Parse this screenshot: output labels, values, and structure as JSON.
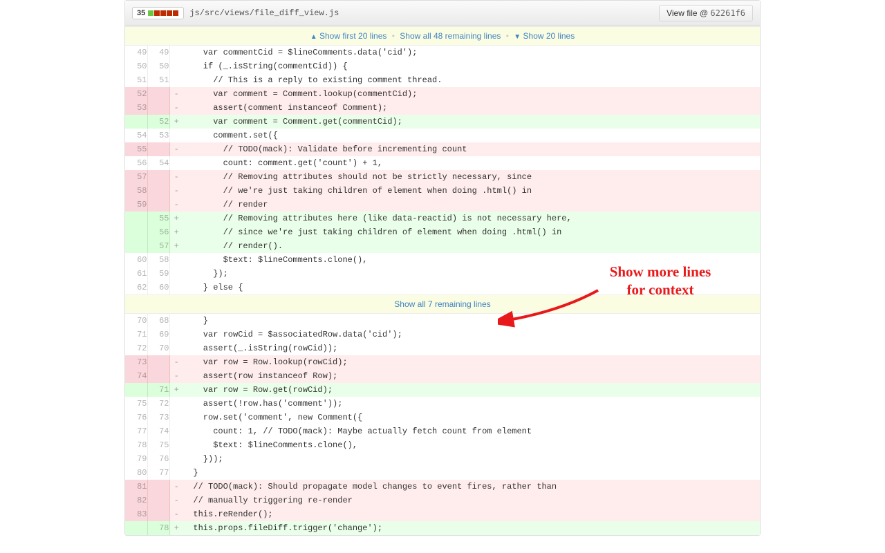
{
  "header": {
    "diffstat_count": "35",
    "file_path": "js/src/views/file_diff_view.js",
    "view_file_label": "View file @",
    "commit_sha": "62261f6"
  },
  "expand_top": {
    "show_first": "Show first 20 lines",
    "show_all": "Show all 48 remaining lines",
    "show_next": "Show 20 lines"
  },
  "expand_mid": {
    "show_all": "Show all 7 remaining lines"
  },
  "annotation_text": "Show more lines\nfor context",
  "rows": [
    {
      "t": "ctx",
      "ol": "49",
      "nl": "49",
      "s": " ",
      "c": "    var commentCid = $lineComments.data('cid');"
    },
    {
      "t": "ctx",
      "ol": "50",
      "nl": "50",
      "s": " ",
      "c": "    if (_.isString(commentCid)) {"
    },
    {
      "t": "ctx",
      "ol": "51",
      "nl": "51",
      "s": " ",
      "c": "      // This is a reply to existing comment thread."
    },
    {
      "t": "del",
      "ol": "52",
      "nl": "",
      "s": "-",
      "c": "      var comment = Comment.lookup(commentCid);"
    },
    {
      "t": "del",
      "ol": "53",
      "nl": "",
      "s": "-",
      "c": "      assert(comment instanceof Comment);"
    },
    {
      "t": "add",
      "ol": "",
      "nl": "52",
      "s": "+",
      "c": "      var comment = Comment.get(commentCid);"
    },
    {
      "t": "ctx",
      "ol": "54",
      "nl": "53",
      "s": " ",
      "c": "      comment.set({"
    },
    {
      "t": "del",
      "ol": "55",
      "nl": "",
      "s": "-",
      "c": "        // TODO(mack): Validate before incrementing count"
    },
    {
      "t": "ctx",
      "ol": "56",
      "nl": "54",
      "s": " ",
      "c": "        count: comment.get('count') + 1,"
    },
    {
      "t": "del",
      "ol": "57",
      "nl": "",
      "s": "-",
      "c": "        // Removing attributes should not be strictly necessary, since"
    },
    {
      "t": "del",
      "ol": "58",
      "nl": "",
      "s": "-",
      "c": "        // we're just taking children of element when doing .html() in"
    },
    {
      "t": "del",
      "ol": "59",
      "nl": "",
      "s": "-",
      "c": "        // render"
    },
    {
      "t": "add",
      "ol": "",
      "nl": "55",
      "s": "+",
      "c": "        // Removing attributes here (like data-reactid) is not necessary here,"
    },
    {
      "t": "add",
      "ol": "",
      "nl": "56",
      "s": "+",
      "c": "        // since we're just taking children of element when doing .html() in"
    },
    {
      "t": "add",
      "ol": "",
      "nl": "57",
      "s": "+",
      "c": "        // render()."
    },
    {
      "t": "ctx",
      "ol": "60",
      "nl": "58",
      "s": " ",
      "c": "        $text: $lineComments.clone(),"
    },
    {
      "t": "ctx",
      "ol": "61",
      "nl": "59",
      "s": " ",
      "c": "      });"
    },
    {
      "t": "ctx",
      "ol": "62",
      "nl": "60",
      "s": " ",
      "c": "    } else {"
    }
  ],
  "rows2": [
    {
      "t": "ctx",
      "ol": "70",
      "nl": "68",
      "s": " ",
      "c": "    }"
    },
    {
      "t": "ctx",
      "ol": "71",
      "nl": "69",
      "s": " ",
      "c": "    var rowCid = $associatedRow.data('cid');"
    },
    {
      "t": "ctx",
      "ol": "72",
      "nl": "70",
      "s": " ",
      "c": "    assert(_.isString(rowCid));"
    },
    {
      "t": "del",
      "ol": "73",
      "nl": "",
      "s": "-",
      "c": "    var row = Row.lookup(rowCid);"
    },
    {
      "t": "del",
      "ol": "74",
      "nl": "",
      "s": "-",
      "c": "    assert(row instanceof Row);"
    },
    {
      "t": "add",
      "ol": "",
      "nl": "71",
      "s": "+",
      "c": "    var row = Row.get(rowCid);"
    },
    {
      "t": "ctx",
      "ol": "75",
      "nl": "72",
      "s": " ",
      "c": "    assert(!row.has('comment'));"
    },
    {
      "t": "ctx",
      "ol": "76",
      "nl": "73",
      "s": " ",
      "c": "    row.set('comment', new Comment({"
    },
    {
      "t": "ctx",
      "ol": "77",
      "nl": "74",
      "s": " ",
      "c": "      count: 1, // TODO(mack): Maybe actually fetch count from element"
    },
    {
      "t": "ctx",
      "ol": "78",
      "nl": "75",
      "s": " ",
      "c": "      $text: $lineComments.clone(),"
    },
    {
      "t": "ctx",
      "ol": "79",
      "nl": "76",
      "s": " ",
      "c": "    }));"
    },
    {
      "t": "ctx",
      "ol": "80",
      "nl": "77",
      "s": " ",
      "c": "  }"
    },
    {
      "t": "del",
      "ol": "81",
      "nl": "",
      "s": "-",
      "c": "  // TODO(mack): Should propagate model changes to event fires, rather than"
    },
    {
      "t": "del",
      "ol": "82",
      "nl": "",
      "s": "-",
      "c": "  // manually triggering re-render"
    },
    {
      "t": "del",
      "ol": "83",
      "nl": "",
      "s": "-",
      "c": "  this.reRender();"
    },
    {
      "t": "add",
      "ol": "",
      "nl": "78",
      "s": "+",
      "c": "  this.props.fileDiff.trigger('change');"
    }
  ]
}
